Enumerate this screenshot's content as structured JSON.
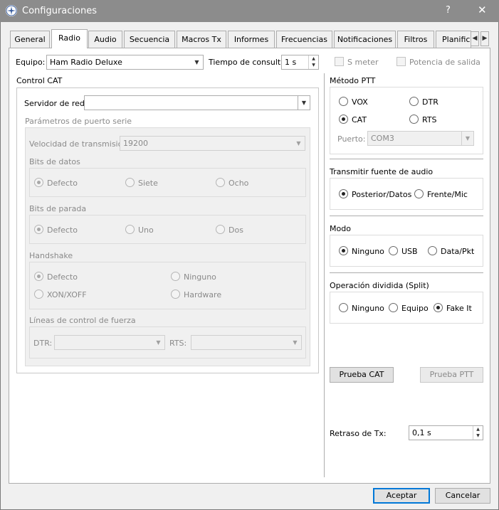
{
  "window": {
    "title": "Configuraciones",
    "help": "?",
    "close": "✕"
  },
  "tabs": [
    "General",
    "Radio",
    "Audio",
    "Secuencia",
    "Macros Tx",
    "Informes",
    "Frecuencias",
    "Notificaciones",
    "Filtros",
    "Planifica"
  ],
  "tab_scroll": {
    "left": "◀",
    "right": "▶"
  },
  "top": {
    "equipo_label": "Equipo:",
    "equipo_value": "Ham Radio Deluxe",
    "poll_label": "Tiempo de consulta:",
    "poll_value": "1 s",
    "smeter_label": "S meter",
    "potencia_label": "Potencia de salida"
  },
  "cat": {
    "title": "Control CAT",
    "servidor_label": "Servidor de red:",
    "servidor_value": "",
    "serial_title": "Parámetros de puerto serie",
    "baud_label": "Velocidad de transmisión:",
    "baud_value": "19200",
    "databits_title": "Bits de datos",
    "databits": [
      "Defecto",
      "Siete",
      "Ocho"
    ],
    "stopbits_title": "Bits de parada",
    "stopbits": [
      "Defecto",
      "Uno",
      "Dos"
    ],
    "handshake_title": "Handshake",
    "handshake": [
      "Defecto",
      "Ninguno",
      "XON/XOFF",
      "Hardware"
    ],
    "force_title": "Líneas de control de fuerza",
    "dtr_label": "DTR:",
    "rts_label": "RTS:"
  },
  "ptt": {
    "title": "Método PTT",
    "options": [
      "VOX",
      "DTR",
      "CAT",
      "RTS"
    ],
    "selected": "CAT",
    "port_label": "Puerto:",
    "port_value": "COM3"
  },
  "audio": {
    "title": "Transmitir fuente de audio",
    "options": [
      "Posterior/Datos",
      "Frente/Mic"
    ],
    "selected": "Posterior/Datos"
  },
  "mode": {
    "title": "Modo",
    "options": [
      "Ninguno",
      "USB",
      "Data/Pkt"
    ],
    "selected": "Ninguno"
  },
  "split": {
    "title": "Operación dividida (Split)",
    "options": [
      "Ninguno",
      "Equipo",
      "Fake It"
    ],
    "selected": "Fake It"
  },
  "tests": {
    "cat": "Prueba CAT",
    "ptt": "Prueba PTT"
  },
  "txdelay": {
    "label": "Retraso de Tx:",
    "value": "0,1 s"
  },
  "footer": {
    "ok": "Aceptar",
    "cancel": "Cancelar"
  },
  "icons": {
    "spin_up": "▲",
    "spin_down": "▼",
    "dropdown": "▼"
  }
}
